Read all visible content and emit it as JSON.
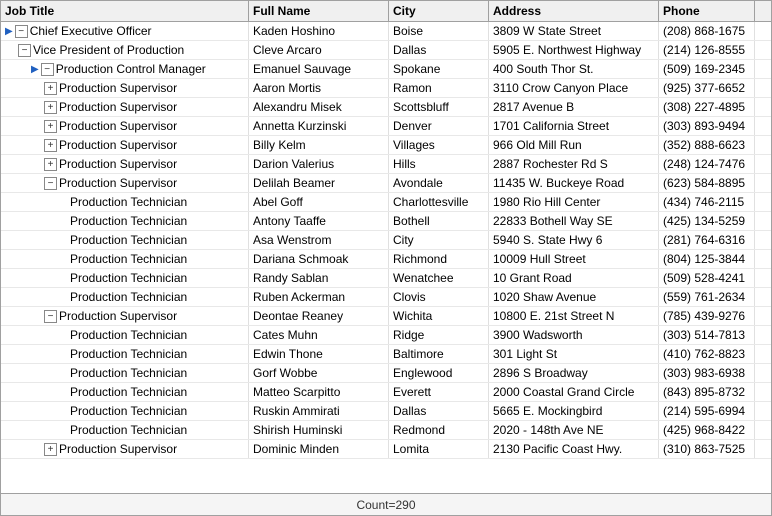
{
  "headers": {
    "jobtitle": "Job Title",
    "fullname": "Full Name",
    "city": "City",
    "address": "Address",
    "phone": "Phone"
  },
  "status": {
    "count_label": "Count=290"
  },
  "rows": [
    {
      "id": 1,
      "level": 0,
      "hasExpand": true,
      "expandState": "expanded",
      "title": "Chief Executive Officer",
      "fullname": "Kaden Hoshino",
      "city": "Boise",
      "address": "3809 W State Street",
      "phone": "(208) 868-1675",
      "selected": false,
      "hasArrow": true
    },
    {
      "id": 2,
      "level": 1,
      "hasExpand": true,
      "expandState": "expanded",
      "title": "Vice President of Production",
      "fullname": "Cleve Arcaro",
      "city": "Dallas",
      "address": "5905 E. Northwest Highway",
      "phone": "(214) 126-8555",
      "selected": false,
      "hasArrow": false
    },
    {
      "id": 3,
      "level": 2,
      "hasExpand": true,
      "expandState": "expanded",
      "title": "Production Control Manager",
      "fullname": "Emanuel Sauvage",
      "city": "Spokane",
      "address": "400 South Thor St.",
      "phone": "(509) 169-2345",
      "selected": false,
      "hasArrow": true
    },
    {
      "id": 4,
      "level": 3,
      "hasExpand": true,
      "expandState": "collapsed",
      "title": "Production Supervisor",
      "fullname": "Aaron Mortis",
      "city": "Ramon",
      "address": "3110 Crow Canyon Place",
      "phone": "(925) 377-6652",
      "selected": false,
      "hasArrow": false
    },
    {
      "id": 5,
      "level": 3,
      "hasExpand": true,
      "expandState": "collapsed",
      "title": "Production Supervisor",
      "fullname": "Alexandru Misek",
      "city": "Scottsbluff",
      "address": "2817 Avenue B",
      "phone": "(308) 227-4895",
      "selected": false,
      "hasArrow": false
    },
    {
      "id": 6,
      "level": 3,
      "hasExpand": true,
      "expandState": "collapsed",
      "title": "Production Supervisor",
      "fullname": "Annetta Kurzinski",
      "city": "Denver",
      "address": "1701 California Street",
      "phone": "(303) 893-9494",
      "selected": false,
      "hasArrow": false
    },
    {
      "id": 7,
      "level": 3,
      "hasExpand": true,
      "expandState": "collapsed",
      "title": "Production Supervisor",
      "fullname": "Billy Kelm",
      "city": "Villages",
      "address": "966 Old Mill Run",
      "phone": "(352) 888-6623",
      "selected": false,
      "hasArrow": false
    },
    {
      "id": 8,
      "level": 3,
      "hasExpand": true,
      "expandState": "collapsed",
      "title": "Production Supervisor",
      "fullname": "Darion Valerius",
      "city": "Hills",
      "address": "2887 Rochester Rd S",
      "phone": "(248) 124-7476",
      "selected": false,
      "hasArrow": false
    },
    {
      "id": 9,
      "level": 3,
      "hasExpand": true,
      "expandState": "expanded",
      "title": "Production Supervisor",
      "fullname": "Delilah Beamer",
      "city": "Avondale",
      "address": "11435 W. Buckeye Road",
      "phone": "(623) 584-8895",
      "selected": false,
      "hasArrow": false
    },
    {
      "id": 10,
      "level": 4,
      "hasExpand": false,
      "expandState": "none",
      "title": "Production Technician",
      "fullname": "Abel Goff",
      "city": "Charlottesville",
      "address": "1980 Rio Hill Center",
      "phone": "(434) 746-2115",
      "selected": false,
      "hasArrow": false
    },
    {
      "id": 11,
      "level": 4,
      "hasExpand": false,
      "expandState": "none",
      "title": "Production Technician",
      "fullname": "Antony Taaffe",
      "city": "Bothell",
      "address": "22833 Bothell Way SE",
      "phone": "(425) 134-5259",
      "selected": false,
      "hasArrow": false
    },
    {
      "id": 12,
      "level": 4,
      "hasExpand": false,
      "expandState": "none",
      "title": "Production Technician",
      "fullname": "Asa Wenstrom",
      "city": "City",
      "address": "5940 S. State Hwy 6",
      "phone": "(281) 764-6316",
      "selected": false,
      "hasArrow": false
    },
    {
      "id": 13,
      "level": 4,
      "hasExpand": false,
      "expandState": "none",
      "title": "Production Technician",
      "fullname": "Dariana Schmoak",
      "city": "Richmond",
      "address": "10009 Hull Street",
      "phone": "(804) 125-3844",
      "selected": false,
      "hasArrow": false
    },
    {
      "id": 14,
      "level": 4,
      "hasExpand": false,
      "expandState": "none",
      "title": "Production Technician",
      "fullname": "Randy Sablan",
      "city": "Wenatchee",
      "address": "10 Grant Road",
      "phone": "(509) 528-4241",
      "selected": false,
      "hasArrow": false
    },
    {
      "id": 15,
      "level": 4,
      "hasExpand": false,
      "expandState": "none",
      "title": "Production Technician",
      "fullname": "Ruben Ackerman",
      "city": "Clovis",
      "address": "1020 Shaw Avenue",
      "phone": "(559) 761-2634",
      "selected": false,
      "hasArrow": false
    },
    {
      "id": 16,
      "level": 3,
      "hasExpand": true,
      "expandState": "expanded",
      "title": "Production Supervisor",
      "fullname": "Deontae Reaney",
      "city": "Wichita",
      "address": "10800 E. 21st Street N",
      "phone": "(785) 439-9276",
      "selected": false,
      "hasArrow": false
    },
    {
      "id": 17,
      "level": 4,
      "hasExpand": false,
      "expandState": "none",
      "title": "Production Technician",
      "fullname": "Cates Muhn",
      "city": "Ridge",
      "address": "3900 Wadsworth",
      "phone": "(303) 514-7813",
      "selected": false,
      "hasArrow": false
    },
    {
      "id": 18,
      "level": 4,
      "hasExpand": false,
      "expandState": "none",
      "title": "Production Technician",
      "fullname": "Edwin Thone",
      "city": "Baltimore",
      "address": "301 Light St",
      "phone": "(410) 762-8823",
      "selected": false,
      "hasArrow": false
    },
    {
      "id": 19,
      "level": 4,
      "hasExpand": false,
      "expandState": "none",
      "title": "Production Technician",
      "fullname": "Gorf Wobbe",
      "city": "Englewood",
      "address": "2896 S Broadway",
      "phone": "(303) 983-6938",
      "selected": false,
      "hasArrow": false
    },
    {
      "id": 20,
      "level": 4,
      "hasExpand": false,
      "expandState": "none",
      "title": "Production Technician",
      "fullname": "Matteo Scarpitto",
      "city": "Everett",
      "address": "2000 Coastal Grand Circle",
      "phone": "(843) 895-8732",
      "selected": false,
      "hasArrow": false
    },
    {
      "id": 21,
      "level": 4,
      "hasExpand": false,
      "expandState": "none",
      "title": "Production Technician",
      "fullname": "Ruskin Ammirati",
      "city": "Dallas",
      "address": "5665 E. Mockingbird",
      "phone": "(214) 595-6994",
      "selected": false,
      "hasArrow": false
    },
    {
      "id": 22,
      "level": 4,
      "hasExpand": false,
      "expandState": "none",
      "title": "Production Technician",
      "fullname": "Shirish Huminski",
      "city": "Redmond",
      "address": "2020 - 148th Ave NE",
      "phone": "(425) 968-8422",
      "selected": false,
      "hasArrow": false
    },
    {
      "id": 23,
      "level": 3,
      "hasExpand": true,
      "expandState": "collapsed",
      "title": "Production Supervisor",
      "fullname": "Dominic Minden",
      "city": "Lomita",
      "address": "2130 Pacific Coast Hwy.",
      "phone": "(310) 863-7525",
      "selected": false,
      "hasArrow": false
    }
  ]
}
